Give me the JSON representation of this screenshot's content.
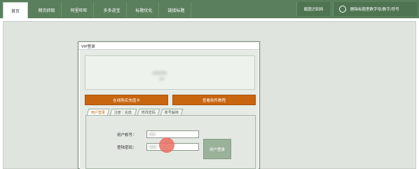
{
  "nav": {
    "items": [
      {
        "label": "首页",
        "active": true
      },
      {
        "label": "网页抓取",
        "active": false
      },
      {
        "label": "阿里旺旺",
        "active": false
      },
      {
        "label": "多多进宝",
        "active": false
      },
      {
        "label": "标题优化",
        "active": false
      },
      {
        "label": "链接标题",
        "active": false
      }
    ],
    "right_button": "截图识别网",
    "right_option": "删除标题里数字母/数字/符号"
  },
  "dialog": {
    "title": "VIP登录",
    "buttons": {
      "buy": "在线购买充值卡",
      "tutorial": "查看软件教程"
    },
    "tabs": [
      "用户登录",
      "注册｜充值",
      "修改密码",
      "账号解绑"
    ],
    "form": {
      "username_label": "用户帐号：",
      "password_label": "登陆密码：",
      "login_button": "用户登录"
    }
  },
  "colors": {
    "topbar": "#5a7f5c",
    "orange_button": "#c8650f",
    "stage_bg": "#dfe4de",
    "cursor_marker": "#e86e60"
  }
}
